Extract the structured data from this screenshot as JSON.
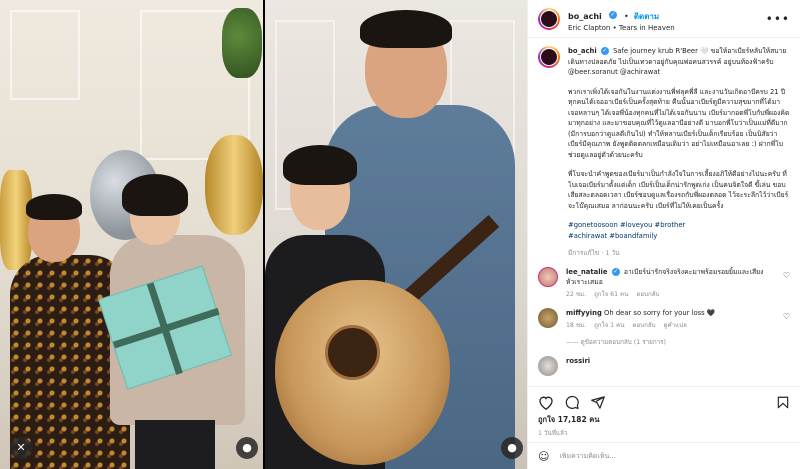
{
  "colors": {
    "accent": "#0095f6",
    "verified": "#3897f0",
    "hashtag": "#00376b",
    "muted": "#8e8e8e"
  },
  "media": {
    "mute_icon": "speaker-muted-icon"
  },
  "header": {
    "username": "bo_achi",
    "follow_label": "ติดตาม",
    "music": "Eric Clapton • Tears in Heaven",
    "more_icon": "more-options-icon"
  },
  "caption": {
    "username": "bo_achi",
    "first_line": "Safe journey krub R'Beer 🤍 ขอให้อาเบียร์หลับให้สบาย เดินทางปลอดภัย ไปเป็นเทวดาอยู่กับคุณพ่อคนสวรรค์ อยู่บนท้องฟ้าครับ @beer.soranut @achirawat",
    "para1": "พวกเราเพิ่งได้เจอกันในงานแต่งงานพี่ฟลุคพี่ลี และงานวันเกิดอาบีครบ 21 ปี ทุกคนได้เจออาเบียร์เป็นครั้งสุดท้าย คืนนั้นอาเบียร์ดูมีความสุขมากที่ได้มาเจอหลานๆ ได้เจอพี่น้องทุกคนที่ไม่ได้เจอกันนาน เบียร์มากอดพี่โบกับพี่ผองคิดมาทุกอย่าง และมาขอบคุณที่ไว้ดูแลอาบีอย่างดี มาบอกพี่โบว่าเป็นแม่ที่ดีมาก (มีการบอกว่าดูแลดีเกินไป) ทำให้หลานเบียร์เป็นเด็กเรียบร้อย เป็นนิสัยว่าเบียร์มีคุณภาพ ยังพูดติดตลกเหมือนเดิมว่า อย่าไม่เหมือนอาเลย :) ฝากพี่โบช่วยดูแลอยู่ตัวด้วยนะครับ",
    "para2": "พี่โบจะนำคำพูดของเบียร์มาเป็นกำลังใจในการเลี้ยงอภิให้ดีอย่างไปนะครับ ที่โบเจอเบียร์มาตั้งแต่เด็ก เบียร์เป็นเด็กน่ารักพูดเก่ง เป็นคนจิตใจดี ขี้เล่น ขอบเสียสละตลอดเวลา เบียร์ชอบดูแลเรื่องรถกับพี่ผองตลอด ไว้จะระลึกไว้ว่าเบียร์จะโบ๊คุณเสมอ ลาก่อนนะครับ เบียร์ที่ไม่ให้เคยเป็นครั้ง",
    "hashtags1": "#gonetoosoon #loveyou #brother",
    "hashtags2": "#achirawat #boandfamily",
    "meta": "มีการแก้ไข · 1 วัน"
  },
  "comments": [
    {
      "username": "lee_natalie",
      "text": "อาเบียร์น่ารักจริงจริงคะมาพร้อมรอยยิ้มและเสียงหัวเราะเสมอ",
      "time": "22 ชม.",
      "likes": "ถูกใจ 61 คน",
      "reply": "ตอบกลับ"
    },
    {
      "username": "miffyying",
      "text": "Oh dear so sorry for your loss 🖤",
      "time": "18 ชม.",
      "likes": "ถูกใจ 1 คน",
      "reply": "ตอบกลับ",
      "translate": "ดูคำแปล",
      "replies": "ดูข้อความตอบกลับ (1 รายการ)"
    },
    {
      "username": "rossiri",
      "text": "",
      "time": "",
      "likes": "",
      "reply": ""
    }
  ],
  "actions": {
    "likes": "ถูกใจ 17,182 คน",
    "date": "1 วันที่แล้ว",
    "icons": [
      "heart-icon",
      "comment-icon",
      "share-icon",
      "bookmark-icon"
    ]
  },
  "comment_box": {
    "emoji_icon": "emoji-icon",
    "placeholder": "เพิ่มความคิดเห็น..."
  }
}
